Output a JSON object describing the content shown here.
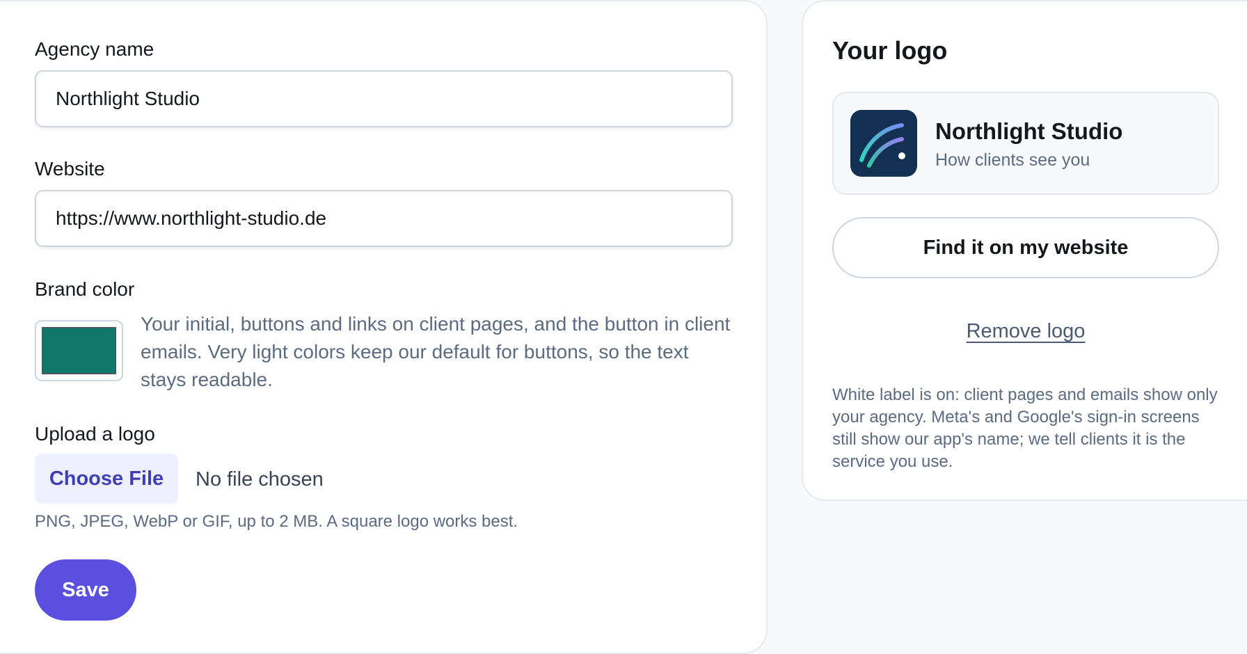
{
  "settings": {
    "agency_name_label": "Agency name",
    "agency_name_value": "Northlight Studio",
    "website_label": "Website",
    "website_value": "https://www.northlight-studio.de",
    "brand_color_label": "Brand color",
    "brand_color_value": "#12786d",
    "brand_color_help": "Your initial, buttons and links on client pages, and the button in client emails. Very light colors keep our default for buttons, so the text stays readable.",
    "upload_label": "Upload a logo",
    "choose_file_label": "Choose File",
    "no_file_text": "No file chosen",
    "upload_hint": "PNG, JPEG, WebP or GIF, up to 2 MB. A square logo works best.",
    "save_label": "Save"
  },
  "logo_panel": {
    "title": "Your logo",
    "preview_name": "Northlight Studio",
    "preview_subtitle": "How clients see you",
    "find_button_label": "Find it on my website",
    "remove_link_label": "Remove logo",
    "white_label_note": "White label is on: client pages and emails show only your agency. Meta's and Google's sign-in screens still show our app's name; we tell clients it is the service you use."
  },
  "colors": {
    "accent": "#5b4fe0",
    "brand": "#12786d",
    "logo_background": "#132f52"
  }
}
